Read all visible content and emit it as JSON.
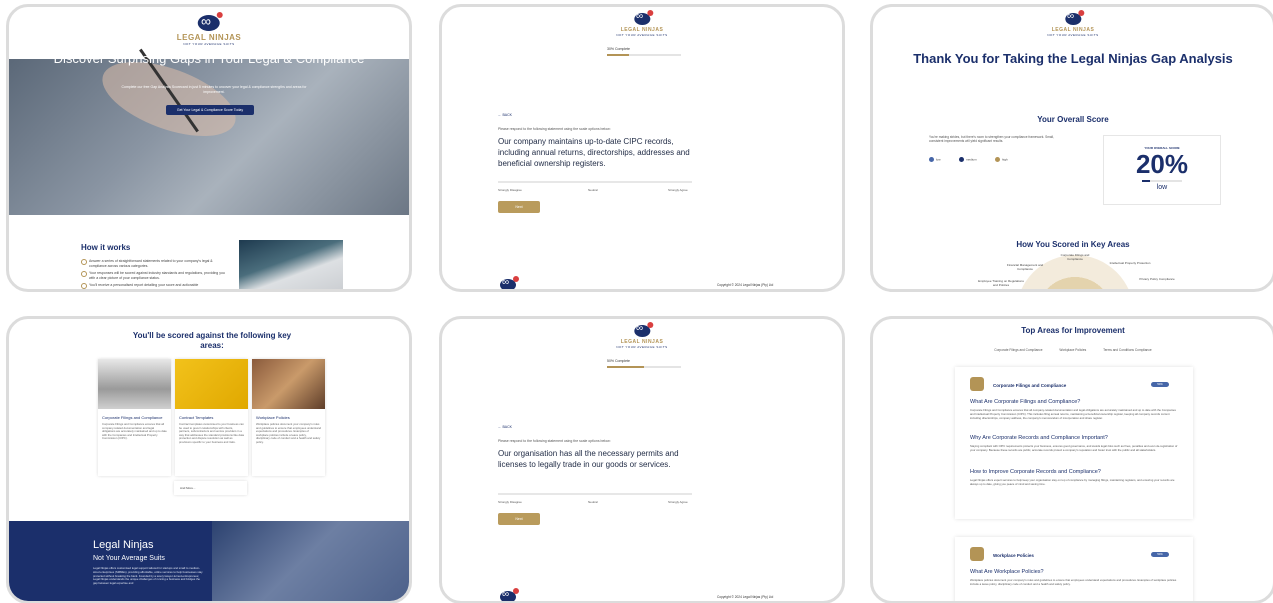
{
  "brand": {
    "name": "LEGAL NINJAS",
    "tagline": "NOT YOUR AVERAGE SUITS"
  },
  "landing": {
    "hero_title": "Discover Surprising Gaps in Your Legal & Compliance",
    "hero_subtitle": "Complete our free Gap Analysis Scorecard in just 5 minutes to uncover your legal & compliance strengths and areas for improvement.",
    "cta": "Get Your Legal & Compliance Score Today",
    "how_title": "How it works",
    "how_items": [
      "Answer a series of straightforward statements related to your company's legal & compliance across various categories.",
      "Your responses will be scored against industry standards and regulations, providing you with a clear picture of your compliance status.",
      "You'll receive a personalised report detailing your score and actionable"
    ]
  },
  "survey1": {
    "progress_label": "30% Complete",
    "progress_value": 0.3,
    "back": "← BACK",
    "prompt": "Please respond to the following statement using the scale options below:",
    "question": "Our company maintains up-to-date CIPC records, including annual returns, directorships, addresses and beneficial ownership registers.",
    "scale": [
      "Strongly Disagree",
      "Neutral",
      "Strongly Agree"
    ],
    "next": "Next"
  },
  "survey2": {
    "progress_label": "50% Complete",
    "progress_value": 0.5,
    "back": "← BACK",
    "prompt": "Please respond to the following statement using the scale options below:",
    "question": "Our organisation has all the necessary permits and licenses to legally trade in our goods or services.",
    "scale": [
      "Strongly Disagree",
      "Neutral",
      "Strongly Agree"
    ],
    "next": "Next"
  },
  "footer": {
    "copyright": "Copyright © 2024 Legal Ninjas (Pty) Ltd"
  },
  "results": {
    "title": "Thank You for Taking the Legal Ninjas Gap Analysis",
    "overall_heading": "Your Overall Score",
    "overall_text": "You're making strides, but there's room to strengthen your compliance framework. Small, consistent improvements will yield significant results.",
    "legend": [
      "low",
      "medium",
      "high"
    ],
    "legend_colors": [
      "#4666a8",
      "#1b2f6b",
      "#b39456"
    ],
    "score_caption": "YOUR OVERALL SCORE",
    "score_value": "20%",
    "score_fraction": 0.2,
    "score_level": "low",
    "key_heading": "How You Scored in Key Areas",
    "radar_labels": [
      "Corporate Filings and Compliance",
      "Financial Management and Compliance",
      "Intellectual Property Protection",
      "Employee Training on Regulations and Policies",
      "Privacy Policy Compliance"
    ]
  },
  "areas": {
    "heading": "You'll be scored against the following key areas:",
    "cards": [
      {
        "title": "Corporate Filings and Compliance",
        "text": "Corporate Filings and Compliance ensures that all company-related documentation and legal obligations are accurately maintained and up to date with the Companies and Intellectual Property Commission (CIPC)."
      },
      {
        "title": "Contract Templates",
        "text": "Contract templates customised to your business can be used to govern relationships with clients, partners, subcontractors and service providers in a way that addresses the standard provisions like data protection and dispute resolution as well as provisions specific to your business and risks."
      },
      {
        "title": "Workplace Policies",
        "text": "Workplace policies document your company's rules and guidelines to ensure that employees understand expectations and procedures. Examples of workplace policies include a leave policy, disciplinary code of conduct and a health and safety policy."
      }
    ],
    "more": "And More...",
    "about_title": "Legal Ninjas",
    "about_subtitle": "Not Your Average Suits",
    "about_text": "Legal Ninjas offers customised legal support tailored for startups and small to medium-sized enterprises (SMMEs), providing affordable, online services to help businesses stay protected without breaking the bank. Founded by a savvy lawyer-turned-entrepreneur, Legal Ninjas understands the unique challenges of running a business and bridges the gap between legal expertise and"
  },
  "improvement": {
    "heading": "Top Areas for Improvement",
    "tabs": [
      "Corporate Filings and Compliance",
      "Workplace Policies",
      "Terms and Conditions Compliance"
    ],
    "items": [
      {
        "name": "Corporate Filings and Compliance",
        "pill": "50%",
        "sections": [
          {
            "h": "What Are Corporate Filings and Compliance?",
            "p": "Corporate Filings and Compliance ensures that all company-related documentation and legal obligations are accurately maintained and up to date with the Companies and Intellectual Property Commission (CIPC). This includes filing annual returns, maintaining a beneficial ownership register, keeping all company records current including directorships, company address, the company's memorandum of incorporation and share register."
          },
          {
            "h": "Why Are Corporate Records and Compliance Important?",
            "p": "Staying compliant with CIPC requirements protects your business, ensures good governance, and avoids legal risks such as fines, penalties and even de-registration of your company. Because these records are public, accurate records protect a company's reputation and foster trust with the public and all stakeholders."
          },
          {
            "h": "How to Improve Corporate Records and Compliance?",
            "p": "Legal Ninjas offers expert services to help keep your organisation stay on top of compliance by managing filings, maintaining registers, and ensuring your records are always up to date, giving you peace of mind and saving time."
          }
        ]
      },
      {
        "name": "Workplace Policies",
        "pill": "50%",
        "sections": [
          {
            "h": "What Are Workplace Policies?",
            "p": "Workplace policies document your company's rules and guidelines to ensure that employees understand expectations and procedures. Examples of workplace policies include a leave policy, disciplinary code of conduct and a health and safety policy."
          }
        ]
      }
    ]
  }
}
